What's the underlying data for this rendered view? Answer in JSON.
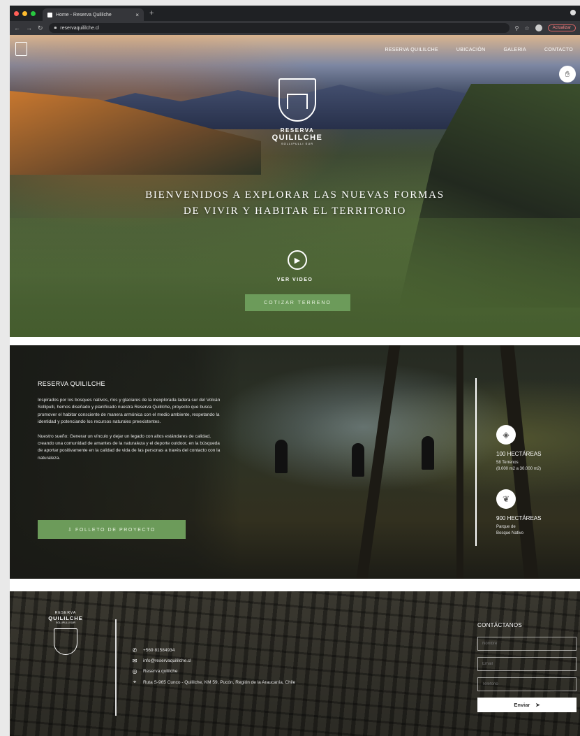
{
  "browser": {
    "tab_title": "Home - Reserva Quililche",
    "tab_close": "×",
    "new_tab": "+",
    "url": "reservaquililche.cl",
    "update_label": "Actualizar",
    "traffic_colors": [
      "#ff5f57",
      "#febc2e",
      "#28c840"
    ]
  },
  "nav": {
    "items": [
      "RESERVA QUILILCHE",
      "UBICACIÓN",
      "GALERIA",
      "CONTACTO"
    ]
  },
  "hero": {
    "brand_line1": "RESERVA",
    "brand_line2": "QUILILCHE",
    "brand_line3": "SOLLIPULLI SUR",
    "headline_line1": "BIENVENIDOS A EXPLORAR LAS NUEVAS FORMAS",
    "headline_line2": "DE VIVIR Y HABITAR EL TERRITORIO",
    "video_label": "VER VIDEO",
    "cta_label": "COTIZAR TERRENO"
  },
  "about": {
    "title": "RESERVA QUILILCHE",
    "paragraph1": "Inspirados por los bosques nativos, ríos y glaciares de la inexplorada ladera sur del Volcán Sollipulli, hemos diseñado y planificado nuestra Reserva Quililche, proyecto que busca promover el habitar consciente de manera armónica con el medio ambiente, respetando la identidad y potenciando los recursos naturales preexistentes.",
    "paragraph2": "Nuestro sueño: Generar un vínculo y dejar un legado con altos estándares de calidad, creando una comunidad de amantes de la naturaleza y el deporte outdoor, en la búsqueda de aportar positivamente en la calidad de vida de las personas a través del contacto con la naturaleza.",
    "brochure_label": "⇩ FOLLETO DE PROYECTO",
    "stats": [
      {
        "value": "100 HECTÁREAS",
        "line1": "58 Terrenos",
        "line2": "(8.000 m2 a 30.000 m2)"
      },
      {
        "value": "900 HECTÁREAS",
        "line1": "Parque de",
        "line2": "Bosque Nativo"
      }
    ]
  },
  "footer": {
    "brand_line1": "RESERVA",
    "brand_line2": "QUILILCHE",
    "brand_line3": "SOLLIPULLI SUR",
    "phone": "+569 81584934",
    "email": "info@reservaquililche.cl",
    "instagram": "Reserva.quililche",
    "address": "Ruta S-965 Cunco - Quililche, KM 59, Pucón, Región de la Araucanía, Chile",
    "contact_title": "CONTÁCTANOS",
    "name_placeholder": "Nombre",
    "email_placeholder": "Email",
    "phone_placeholder": "Teléfono",
    "send_label": "Enviar"
  }
}
